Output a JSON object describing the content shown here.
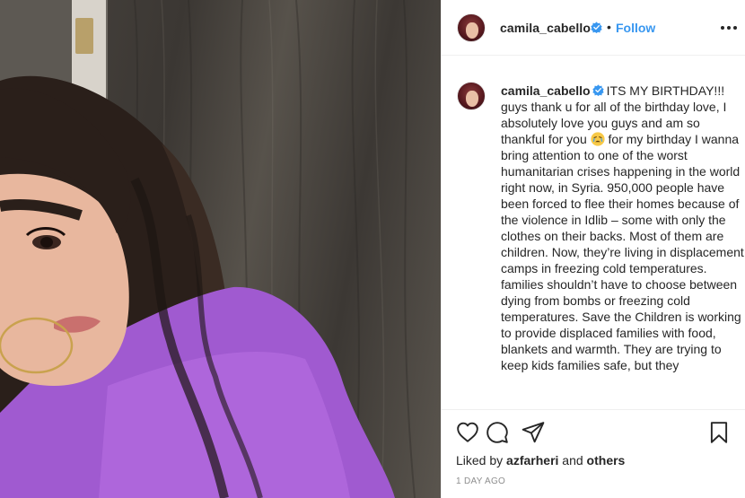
{
  "post": {
    "username": "camila_cabello",
    "separator": "•",
    "follow_label": "Follow",
    "more_icon": "more-horizontal-icon",
    "caption_username": "camila_cabello",
    "caption_text_before_emoji": "ITS MY BIRTHDAY!!! guys thank u for all of the birthday love, I absolutely love you guys and am so thankful for you ",
    "caption_text_after_emoji": " for my birthday I wanna bring attention to one of the worst humanitarian crises happening in the world right now, in Syria. 950,000 people have been forced to flee their homes because of the violence in Idlib – some with only the clothes on their backs. Most of them are children. Now, they’re living in displacement camps in freezing cold temperatures. families shouldn’t have to choose between dying from bombs or freezing cold temperatures. Save the Children is working to provide displaced families with food, blankets and warmth. They are trying to keep kids families safe, but they",
    "caption_emoji": "crying-face-emoji",
    "liked_by_prefix": "Liked by ",
    "liked_by_user": "azfarheri",
    "liked_by_suffix_and": " and ",
    "liked_by_others": "others",
    "timestamp": "1 DAY AGO"
  },
  "colors": {
    "accent": "#3897f0",
    "text": "#262626",
    "muted": "#8e8e8e",
    "divider": "#efefef",
    "sweater": "#a05ad0"
  },
  "icons": {
    "like": "heart-icon",
    "comment": "comment-icon",
    "share": "paper-plane-icon",
    "save": "bookmark-icon",
    "verified": "verified-badge-icon"
  }
}
